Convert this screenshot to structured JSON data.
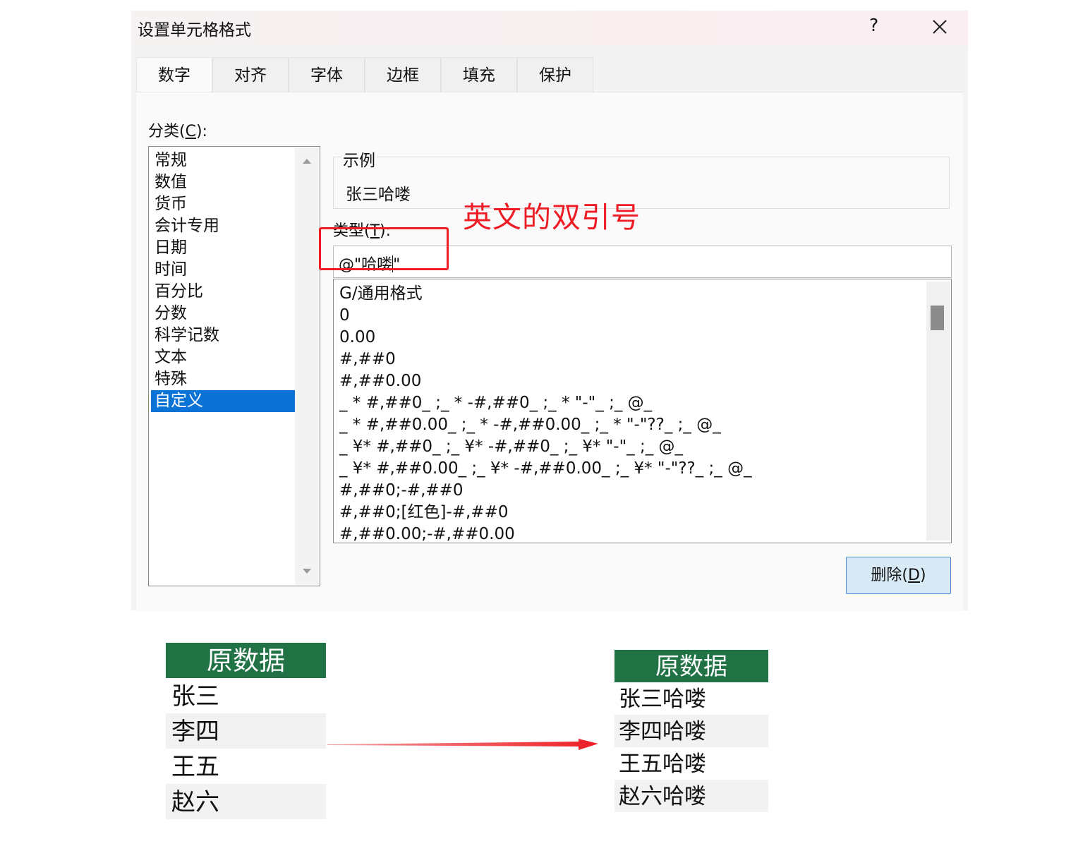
{
  "dialog": {
    "title": "设置单元格格式",
    "help": "?",
    "tabs": [
      "数字",
      "对齐",
      "字体",
      "边框",
      "填充",
      "保护"
    ],
    "active_tab": "数字",
    "category": {
      "label_pre": "分类(",
      "label_key": "C",
      "label_post": "):",
      "items": [
        "常规",
        "数值",
        "货币",
        "会计专用",
        "日期",
        "时间",
        "百分比",
        "分数",
        "科学记数",
        "文本",
        "特殊",
        "自定义"
      ],
      "selected": "自定义"
    },
    "sample": {
      "legend": "示例",
      "value": "张三哈喽"
    },
    "type": {
      "label_pre": "类型(",
      "label_key": "T",
      "label_post": "):",
      "value_before_caret": "@\"哈喽",
      "value_after_caret": "\""
    },
    "formats": [
      "G/通用格式",
      "0",
      "0.00",
      "#,##0",
      "#,##0.00",
      "_ * #,##0_ ;_ * -#,##0_ ;_ * \"-\"_ ;_ @_",
      "_ * #,##0.00_ ;_ * -#,##0.00_ ;_ * \"-\"??_ ;_ @_",
      "_ ¥* #,##0_ ;_ ¥* -#,##0_ ;_ ¥* \"-\"_ ;_ @_",
      "_ ¥* #,##0.00_ ;_ ¥* -#,##0.00_ ;_ ¥* \"-\"??_ ;_ @_",
      "#,##0;-#,##0",
      "#,##0;[红色]-#,##0",
      "#,##0.00;-#,##0.00"
    ],
    "delete_button": {
      "label_pre": "删除(",
      "label_key": "D",
      "label_post": ")"
    }
  },
  "annotation": {
    "note": "英文的双引号",
    "color": "#ee1c25"
  },
  "tables": {
    "header_color": "#217346",
    "before": {
      "header": "原数据",
      "rows": [
        "张三",
        "李四",
        "王五",
        "赵六"
      ]
    },
    "after": {
      "header": "原数据",
      "rows": [
        "张三哈喽",
        "李四哈喽",
        "王五哈喽",
        "赵六哈喽"
      ]
    }
  },
  "icons": {
    "close": "close-icon",
    "scroll_up": "chevron-up-icon",
    "scroll_down": "chevron-down-icon",
    "arrow": "right-arrow-icon"
  }
}
